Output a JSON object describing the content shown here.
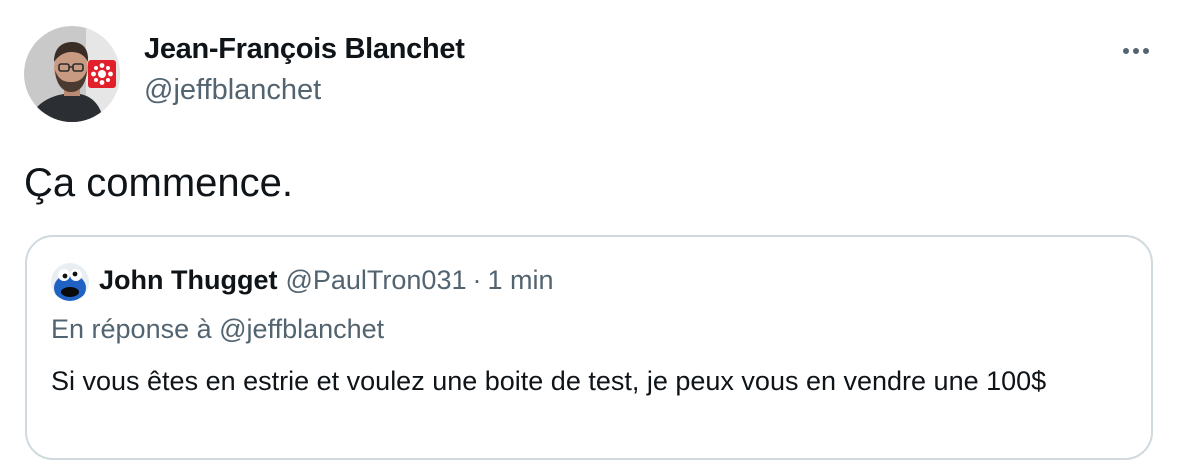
{
  "tweet": {
    "author": {
      "name": "Jean-François Blanchet",
      "handle": "@jeffblanchet"
    },
    "text": "Ça commence.",
    "more_icon": "more-horizontal-icon"
  },
  "quote": {
    "author": {
      "name": "John Thugget",
      "handle": "@PaulTron031"
    },
    "separator": "·",
    "time": "1 min",
    "reply_prefix": "En réponse à",
    "reply_handle": "@jeffblanchet",
    "text": "Si vous êtes en estrie et voulez une boite de test, je peux vous en vendre une 100$"
  },
  "colors": {
    "primary_text": "#0f1419",
    "secondary_text": "#536471",
    "border": "#cfd9de",
    "cbc_red": "#e2202b"
  }
}
